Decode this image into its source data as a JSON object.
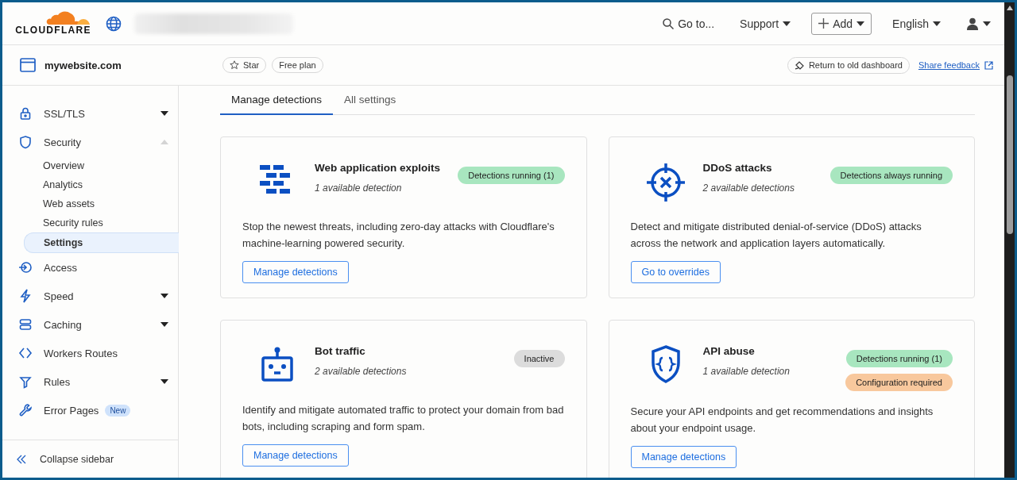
{
  "header": {
    "logo": "CLOUDFLARE",
    "nav": [
      {
        "label": "Go to...",
        "kind": "search"
      },
      {
        "label": "Support",
        "kind": "menu"
      },
      {
        "label": "Add",
        "kind": "add"
      },
      {
        "label": "English",
        "kind": "menu"
      },
      {
        "kind": "user"
      }
    ]
  },
  "site_bar": {
    "domain": "mywebsite.com",
    "chips": [
      "Star",
      "Free plan"
    ],
    "return_button": "Return to old dashboard",
    "feedback_link": "Share feedback"
  },
  "sidebar": {
    "items": [
      {
        "label": "SSL/TLS",
        "expandable": true,
        "expanded": false,
        "selected": false
      },
      {
        "label": "Security",
        "expandable": true,
        "expanded": true,
        "selected": false,
        "children": [
          {
            "label": "Overview",
            "selected": false
          },
          {
            "label": "Analytics",
            "selected": false
          },
          {
            "label": "Web assets",
            "selected": false
          },
          {
            "label": "Security rules",
            "selected": false
          },
          {
            "label": "Settings",
            "selected": true
          }
        ]
      },
      {
        "label": "Access",
        "expandable": false,
        "selected": false
      },
      {
        "label": "Speed",
        "expandable": true,
        "expanded": false,
        "selected": false
      },
      {
        "label": "Caching",
        "expandable": true,
        "expanded": false,
        "selected": false
      },
      {
        "label": "Workers Routes",
        "expandable": false,
        "selected": false
      },
      {
        "label": "Rules",
        "expandable": true,
        "expanded": false,
        "selected": false
      },
      {
        "label": "Error Pages",
        "expandable": false,
        "selected": false,
        "badge": "New"
      }
    ],
    "collapse": "Collapse sidebar"
  },
  "tabs": [
    {
      "label": "Manage detections",
      "selected": true
    },
    {
      "label": "All settings",
      "selected": false
    }
  ],
  "cards": [
    {
      "title": "Web application exploits",
      "subtitle": "1 available detection",
      "badges": [
        {
          "label": "Detections running (1)",
          "color": "#a8e6bf"
        }
      ],
      "description": "Stop the newest threats, including zero-day attacks with Cloudflare's machine-learning powered security.",
      "button": "Manage detections"
    },
    {
      "title": "DDoS attacks",
      "subtitle": "2 available detections",
      "badges": [
        {
          "label": "Detections always running",
          "color": "#a8e6bf"
        }
      ],
      "description": "Detect and mitigate distributed denial-of-service (DDoS) attacks across the network and application layers automatically.",
      "button": "Go to overrides"
    },
    {
      "title": "Bot traffic",
      "subtitle": "2 available detections",
      "badges": [
        {
          "label": "Inactive",
          "color": "#dcdcdc"
        }
      ],
      "description": "Identify and mitigate automated traffic to protect your domain from bad bots, including scraping and form spam.",
      "button": "Manage detections"
    },
    {
      "title": "API abuse",
      "subtitle": "1 available detection",
      "badges": [
        {
          "label": "Detections running (1)",
          "color": "#a8e6bf"
        },
        {
          "label": "Configuration required",
          "color": "#f8c89d"
        }
      ],
      "description": "Secure your API endpoints and get recommendations and insights about your endpoint usage.",
      "button": "Manage detections"
    }
  ]
}
